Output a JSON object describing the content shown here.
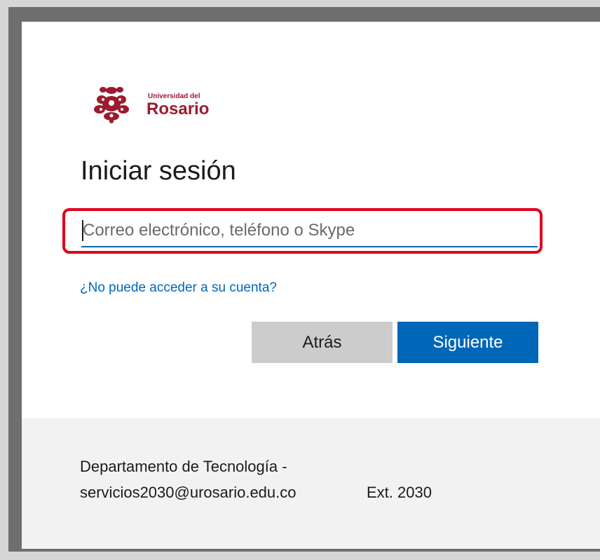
{
  "brand": {
    "logo_line1": "Universidad del",
    "logo_line2": "Rosario",
    "color": "#9b1b30"
  },
  "signin": {
    "title": "Iniciar sesión",
    "email_placeholder": "Correo electrónico, teléfono o Skype",
    "email_value": "",
    "cant_access_link": "¿No puede acceder a su cuenta?",
    "back_label": "Atrás",
    "next_label": "Siguiente"
  },
  "footer": {
    "department": "Departamento de Tecnología -",
    "email": "servicios2030@urosario.edu.co",
    "extension": "Ext. 2030"
  },
  "colors": {
    "accent": "#0067b8",
    "highlight": "#e0001b",
    "back_button": "#cccccc",
    "footer_bg": "#f2f2f2"
  },
  "icons": {
    "logo": "rosario-crest-icon"
  }
}
